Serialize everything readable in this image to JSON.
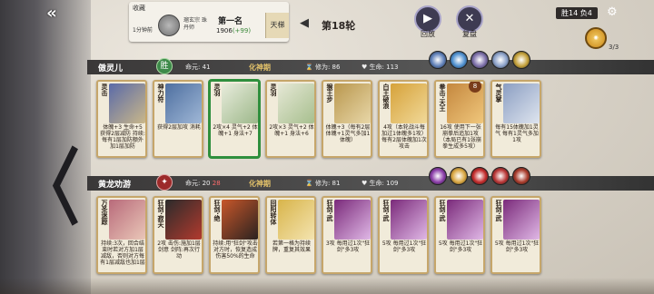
{
  "topbar": {
    "back_icon": "double-arrow-back-icon",
    "collect_label": "收藏",
    "match_time": "1分钟前",
    "player_sub": "瑠玄宗 珠丹师",
    "rank_title": "第一名",
    "rank_score": "1906",
    "rank_gain": "(+99)",
    "ladder_label": "天梯",
    "round_label": "第18轮",
    "replay_label": "回放",
    "review_label": "复盘",
    "wins_text": "胜14 负4",
    "orb_count": "3/3"
  },
  "players": [
    {
      "name": "傲灵儿",
      "sect_char": "胜",
      "life_label": "命元:",
      "life_value": "41",
      "stage": "化神期",
      "cultivation_label": "修为:",
      "cultivation_value": "86",
      "hp_label": "生命:",
      "hp_value": "113",
      "cards": [
        {
          "title": "灵击",
          "text": "体魄+3 生命+5 获得2层减防 持续:每有1层加防额外加1层加防",
          "art": [
            "#5a6aa8",
            "#c9b78a"
          ]
        },
        {
          "title": "神力符",
          "text": "获得2层加攻 消耗",
          "art": [
            "#4e6fa0",
            "#9fb7d6"
          ]
        },
        {
          "title": "灵羽",
          "text": "2攻×4 灵气+2 体魄+1 身法+7",
          "art": [
            "#e8ecdc",
            "#9db88a"
          ],
          "selected": true
        },
        {
          "title": "灵羽",
          "text": "2攻×3 灵气+2 体魄+1 身法+6",
          "art": [
            "#e6e8d6",
            "#a7bf8e"
          ]
        },
        {
          "title": "猴王步",
          "text": "体魄+3（每有2层体魄+1灵气多加1体魄）",
          "art": [
            "#b9974e",
            "#e8d7a8"
          ]
        },
        {
          "title": "白王破浪",
          "text": "4攻（本轮战斗每加过1体魄多1攻）每有2层体魄加1次攻击",
          "art": [
            "#d6a23a",
            "#f1d999"
          ]
        },
        {
          "title": "拳击·天王",
          "text": "16攻 使用下一张崩拳后追加1攻（本局已有1张崩拳生成多5攻）",
          "art": [
            "#c4873e",
            "#f0c77c"
          ],
          "round": "8"
        },
        {
          "title": "气灵掌",
          "text": "每有15体魄加1灵气 每有1灵气多加1攻",
          "art": [
            "#8b9ec2",
            "#dfe5ef"
          ]
        }
      ],
      "buffs": [
        "#5e7fb8",
        "#4d8fcf",
        "#7b6ea8",
        "#8aa0c8",
        "#c4a13a"
      ]
    },
    {
      "name": "黄龙劝游",
      "sect_char": "",
      "life_label": "命元:",
      "life_value": "20",
      "life_extra": "28",
      "stage": "化神期",
      "cultivation_label": "修为:",
      "cultivation_value": "81",
      "hp_label": "生命:",
      "hp_value": "109",
      "cards": [
        {
          "title": "万圣迷踪",
          "text": "持续:3次，回合结束时若对方加1层减敌，否则对方每有1层减敌也加1层",
          "art": [
            "#b86a7a",
            "#eac7b8"
          ]
        },
        {
          "title": "狂剑·寂天",
          "text": "2攻 击伤:施加1层剑意 剑阵:再次行动",
          "art": [
            "#2b2b2b",
            "#b23a2e"
          ]
        },
        {
          "title": "狂剑·绝",
          "text": "持续:用\"狂剑\"攻击对方时，恢复造成伤害50%的生命",
          "art": [
            "#c8572a",
            "#2a2220"
          ]
        },
        {
          "title": "回阳转体",
          "text": "若第一格为持续牌，重复其效果",
          "art": [
            "#d8b44a",
            "#f4e4b0"
          ]
        },
        {
          "title": "狂剑·武",
          "text": "3攻 每用过1次\"狂剑\"多3攻",
          "art": [
            "#7a2a7a",
            "#e0b8e6"
          ]
        },
        {
          "title": "狂剑·武",
          "text": "5攻 每用过1次\"狂剑\"多3攻",
          "art": [
            "#7a2a7a",
            "#e0b8e6"
          ]
        },
        {
          "title": "狂剑·武",
          "text": "5攻 每用过1次\"狂剑\"多3攻",
          "art": [
            "#7a2a7a",
            "#e0b8e6"
          ]
        },
        {
          "title": "狂剑·武",
          "text": "5攻 每用过1次\"狂剑\"多3攻",
          "art": [
            "#7a2a7a",
            "#e0b8e6"
          ]
        }
      ],
      "buffs": [
        "#8a3ca8",
        "#d9a640",
        "#c22a2a",
        "#b83434",
        "#a83a2a"
      ]
    }
  ]
}
